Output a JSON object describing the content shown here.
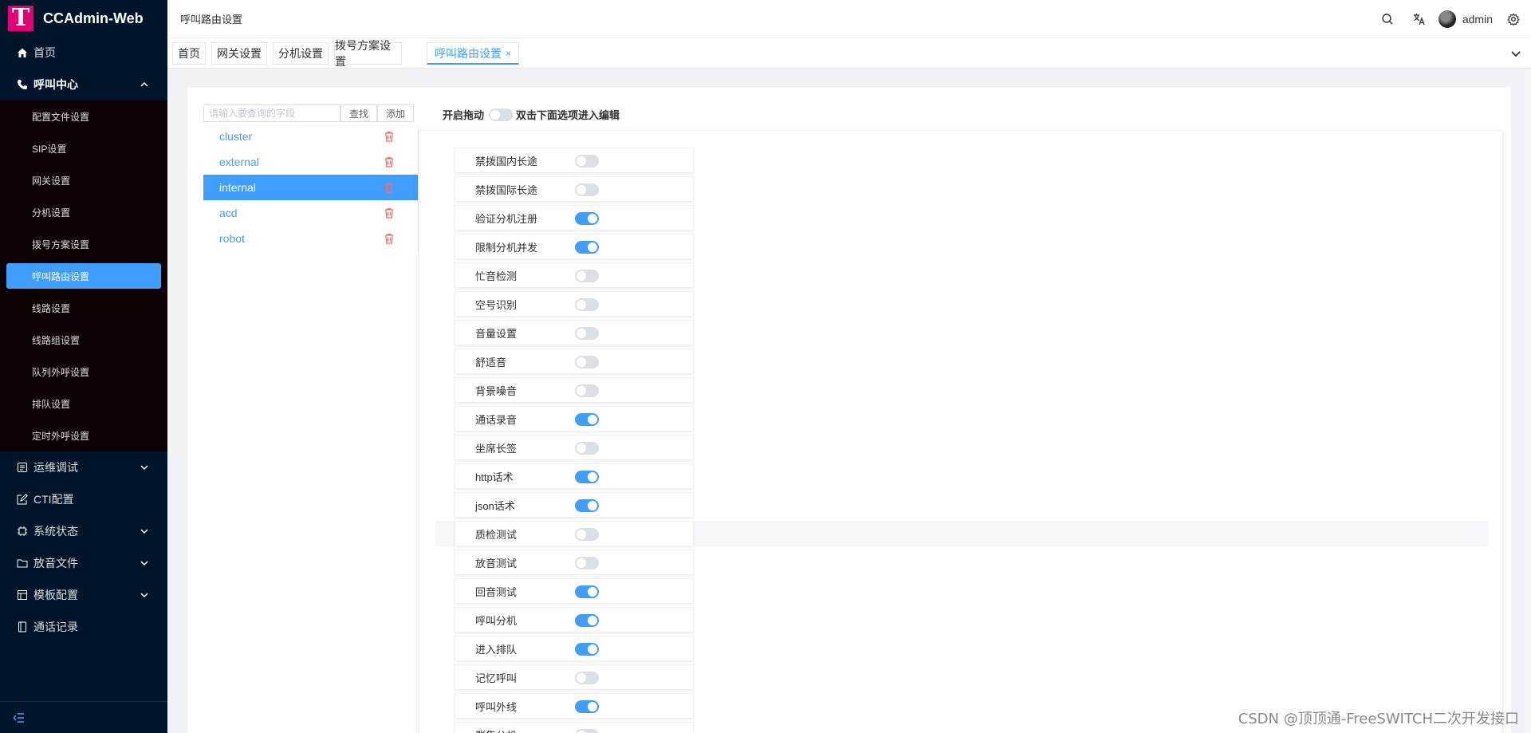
{
  "app": {
    "title": "CCAdmin-Web",
    "logo_letter": "T"
  },
  "sidebar": {
    "items": [
      {
        "label": "首页",
        "icon": "home-icon"
      },
      {
        "label": "呼叫中心",
        "icon": "phone-icon",
        "expanded": true,
        "children": [
          {
            "label": "配置文件设置"
          },
          {
            "label": "SIP设置"
          },
          {
            "label": "网关设置"
          },
          {
            "label": "分机设置"
          },
          {
            "label": "拨号方案设置"
          },
          {
            "label": "呼叫路由设置",
            "active": true
          },
          {
            "label": "线路设置"
          },
          {
            "label": "线路组设置"
          },
          {
            "label": "队列外呼设置"
          },
          {
            "label": "排队设置"
          },
          {
            "label": "定时外呼设置"
          }
        ]
      },
      {
        "label": "运维调试",
        "icon": "debug-icon",
        "has_children": true
      },
      {
        "label": "CTI配置",
        "icon": "edit-icon",
        "has_children": false
      },
      {
        "label": "系统状态",
        "icon": "cpu-icon",
        "has_children": true
      },
      {
        "label": "放音文件",
        "icon": "folder-icon",
        "has_children": true
      },
      {
        "label": "模板配置",
        "icon": "template-icon",
        "has_children": true
      },
      {
        "label": "通话记录",
        "icon": "record-icon",
        "has_children": false
      }
    ]
  },
  "header": {
    "breadcrumb": "呼叫路由设置",
    "username": "admin"
  },
  "tabs": [
    {
      "label": "首页"
    },
    {
      "label": "网关设置"
    },
    {
      "label": "分机设置"
    },
    {
      "label": "拨号方案设置"
    },
    {
      "label": "呼叫路由设置",
      "active": true,
      "close": "×"
    }
  ],
  "search": {
    "placeholder": "请输入要查询的字段",
    "find_label": "查找",
    "add_label": "添加"
  },
  "plans": [
    {
      "name": "cluster"
    },
    {
      "name": "external"
    },
    {
      "name": "internal",
      "active": true
    },
    {
      "name": "acd"
    },
    {
      "name": "robot"
    }
  ],
  "editor": {
    "drag_label": "开启拖动",
    "hint": "双击下面选项进入编辑",
    "drag_enabled": false
  },
  "options": [
    {
      "label": "禁拨国内长途",
      "on": false
    },
    {
      "label": "禁拨国际长途",
      "on": false
    },
    {
      "label": "验证分机注册",
      "on": true
    },
    {
      "label": "限制分机并发",
      "on": true
    },
    {
      "label": "忙音检测",
      "on": false
    },
    {
      "label": "空号识别",
      "on": false
    },
    {
      "label": "音量设置",
      "on": false
    },
    {
      "label": "舒适音",
      "on": false
    },
    {
      "label": "背景噪音",
      "on": false
    },
    {
      "label": "通话录音",
      "on": true
    },
    {
      "label": "坐席长签",
      "on": false
    },
    {
      "label": "http话术",
      "on": true
    },
    {
      "label": "json话术",
      "on": true
    },
    {
      "label": "质检测试",
      "on": false
    },
    {
      "label": "放音测试",
      "on": false
    },
    {
      "label": "回音测试",
      "on": true
    },
    {
      "label": "呼叫分机",
      "on": true
    },
    {
      "label": "进入排队",
      "on": true
    },
    {
      "label": "记忆呼叫",
      "on": false
    },
    {
      "label": "呼叫外线",
      "on": true
    },
    {
      "label": "群集分机",
      "on": false
    }
  ],
  "watermark": "CSDN @顶顶通-FreeSWITCH二次开发接口",
  "colors": {
    "primary": "#409eff",
    "sidebar_bg": "#001529",
    "danger": "#f56c6c",
    "logo": "#e20074"
  }
}
